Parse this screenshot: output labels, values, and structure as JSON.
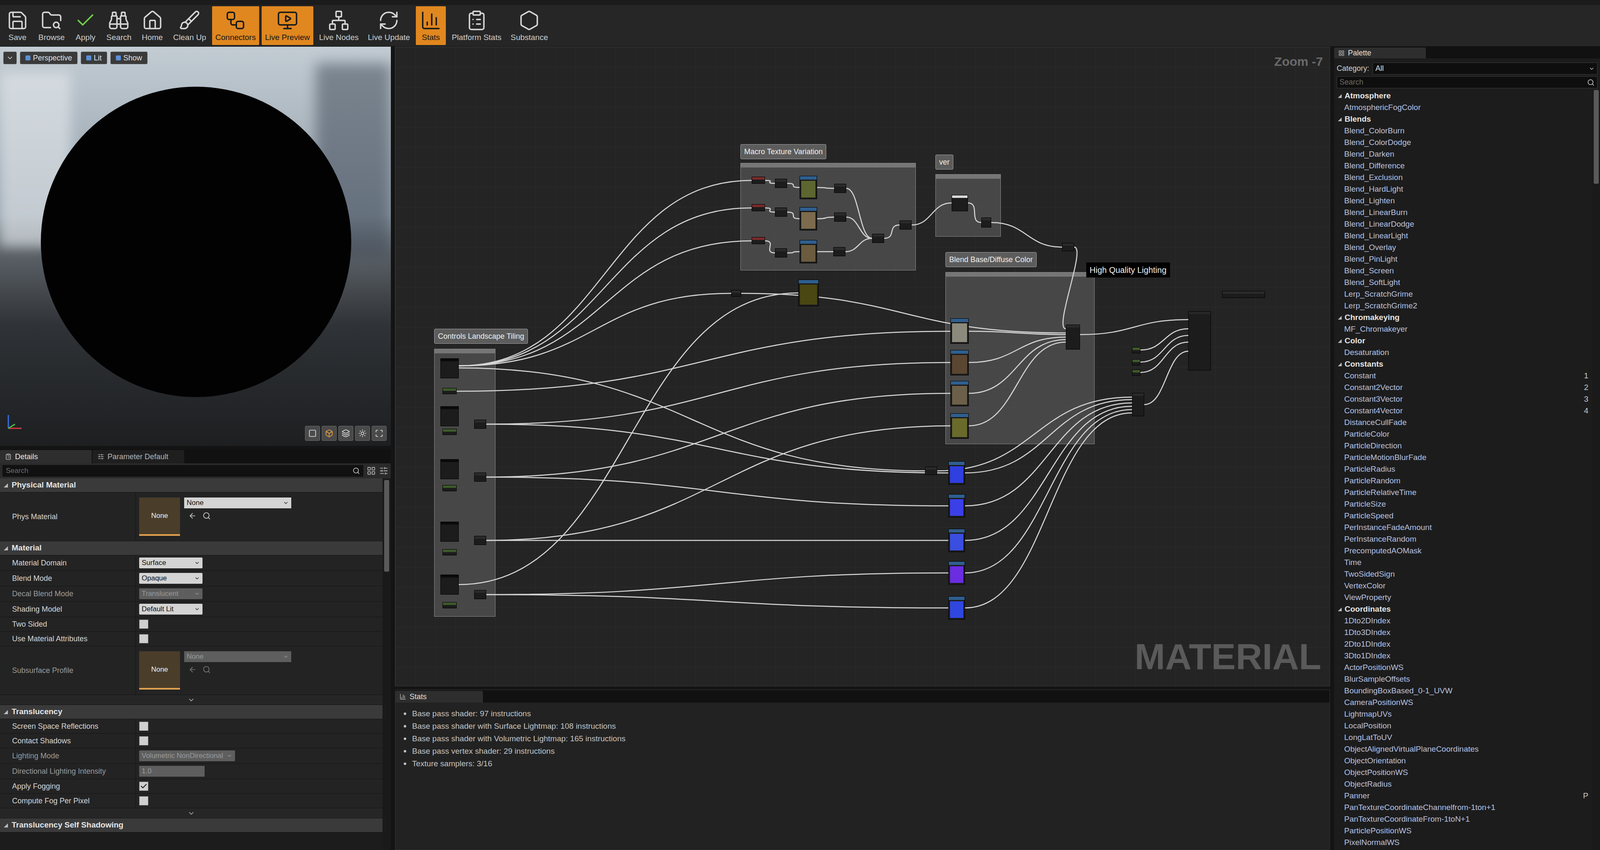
{
  "toolbar": [
    {
      "label": "Save",
      "selected": false
    },
    {
      "label": "Browse",
      "selected": false
    },
    {
      "label": "Apply",
      "selected": false
    },
    {
      "label": "Search",
      "selected": false
    },
    {
      "label": "Home",
      "selected": false
    },
    {
      "label": "Clean Up",
      "selected": false
    },
    {
      "label": "Connectors",
      "selected": true
    },
    {
      "label": "Live Preview",
      "selected": true
    },
    {
      "label": "Live Nodes",
      "selected": false
    },
    {
      "label": "Live Update",
      "selected": false
    },
    {
      "label": "Stats",
      "selected": true
    },
    {
      "label": "Platform Stats",
      "selected": false
    },
    {
      "label": "Substance",
      "selected": false
    }
  ],
  "viewport": {
    "buttons": [
      {
        "label": "Perspective"
      },
      {
        "label": "Lit"
      },
      {
        "label": "Show"
      }
    ]
  },
  "details": {
    "tabs": [
      {
        "label": "Details",
        "selected": true
      },
      {
        "label": "Parameter Default",
        "selected": false
      }
    ],
    "search": "Search",
    "sections": [
      {
        "title": "Physical Material",
        "expanded": true,
        "advanced": false,
        "rows": [
          {
            "label": "Phys Material",
            "kind": "asset",
            "thumb": "None",
            "value": "None",
            "disabled": false
          }
        ]
      },
      {
        "title": "Material",
        "expanded": true,
        "advanced": true,
        "rows": [
          {
            "label": "Material Domain",
            "kind": "select",
            "value": "Surface",
            "disabled": false
          },
          {
            "label": "Blend Mode",
            "kind": "select",
            "value": "Opaque",
            "disabled": false
          },
          {
            "label": "Decal Blend Mode",
            "kind": "select",
            "value": "Translucent",
            "disabled": true
          },
          {
            "label": "Shading Model",
            "kind": "select",
            "value": "Default Lit",
            "disabled": false
          },
          {
            "label": "Two Sided",
            "kind": "checkbox",
            "checked": false,
            "disabled": false
          },
          {
            "label": "Use Material Attributes",
            "kind": "checkbox",
            "checked": false,
            "disabled": false
          },
          {
            "label": "Subsurface Profile",
            "kind": "asset",
            "thumb": "None",
            "value": "None",
            "disabled": true
          }
        ]
      },
      {
        "title": "Translucency",
        "expanded": true,
        "advanced": true,
        "rows": [
          {
            "label": "Screen Space Reflections",
            "kind": "checkbox",
            "checked": false,
            "disabled": false
          },
          {
            "label": "Contact Shadows",
            "kind": "checkbox",
            "checked": false,
            "disabled": false
          },
          {
            "label": "Lighting Mode",
            "kind": "select",
            "value": "Volumetric NonDirectional",
            "disabled": true
          },
          {
            "label": "Directional Lighting Intensity",
            "kind": "number",
            "value": "1.0",
            "disabled": true
          },
          {
            "label": "Apply Fogging",
            "kind": "checkbox",
            "checked": true,
            "disabled": false
          },
          {
            "label": "Compute Fog Per Pixel",
            "kind": "checkbox",
            "checked": false,
            "disabled": false
          }
        ]
      },
      {
        "title": "Translucency Self Shadowing",
        "expanded": true,
        "advanced": false,
        "rows": []
      }
    ]
  },
  "graph": {
    "zoom": "Zoom -7",
    "watermark": "MATERIAL",
    "tooltip": "High Quality Lighting",
    "comments": [
      {
        "title": "Macro Texture Variation"
      },
      {
        "title": "ver"
      },
      {
        "title": "Blend Base/Diffuse Color"
      },
      {
        "title": "Controls Landscape Tiling"
      }
    ],
    "textures": [
      {
        "color": "#5d6630"
      },
      {
        "color": "#7d6b4d"
      },
      {
        "color": "#6b5c3f"
      },
      {
        "color": "#4a4712"
      },
      {
        "color": "#8c8a7c"
      },
      {
        "color": "#5b4631"
      },
      {
        "color": "#6d604a"
      },
      {
        "color": "#6a6a2c"
      },
      {
        "color": "#2f3fe0"
      },
      {
        "color": "#3b3fe8"
      },
      {
        "color": "#3a4ee0"
      },
      {
        "color": "#6a2de0"
      },
      {
        "color": "#3046e0"
      }
    ]
  },
  "stats": {
    "tab": "Stats",
    "lines": [
      "Base pass shader: 97 instructions",
      "Base pass shader with Surface Lightmap: 108 instructions",
      "Base pass shader with Volumetric Lightmap: 165 instructions",
      "Base pass vertex shader: 29 instructions",
      "Texture samplers: 3/16"
    ]
  },
  "palette": {
    "tab": "Palette",
    "category_label": "Category:",
    "category": "All",
    "search": "Search",
    "groups": [
      {
        "title": "Atmosphere",
        "expanded": true,
        "items": [
          {
            "label": "AtmosphericFogColor"
          }
        ]
      },
      {
        "title": "Blends",
        "expanded": true,
        "items": [
          {
            "label": "Blend_ColorBurn"
          },
          {
            "label": "Blend_ColorDodge"
          },
          {
            "label": "Blend_Darken"
          },
          {
            "label": "Blend_Difference"
          },
          {
            "label": "Blend_Exclusion"
          },
          {
            "label": "Blend_HardLight"
          },
          {
            "label": "Blend_Lighten"
          },
          {
            "label": "Blend_LinearBurn"
          },
          {
            "label": "Blend_LinearDodge"
          },
          {
            "label": "Blend_LinearLight"
          },
          {
            "label": "Blend_Overlay"
          },
          {
            "label": "Blend_PinLight"
          },
          {
            "label": "Blend_Screen"
          },
          {
            "label": "Blend_SoftLight"
          },
          {
            "label": "Lerp_ScratchGrime"
          },
          {
            "label": "Lerp_ScratchGrime2"
          }
        ]
      },
      {
        "title": "Chromakeying",
        "expanded": true,
        "items": [
          {
            "label": "MF_Chromakeyer"
          }
        ]
      },
      {
        "title": "Color",
        "expanded": true,
        "items": [
          {
            "label": "Desaturation"
          }
        ]
      },
      {
        "title": "Constants",
        "expanded": true,
        "items": [
          {
            "label": "Constant",
            "shortcut": "1"
          },
          {
            "label": "Constant2Vector",
            "shortcut": "2"
          },
          {
            "label": "Constant3Vector",
            "shortcut": "3"
          },
          {
            "label": "Constant4Vector",
            "shortcut": "4"
          },
          {
            "label": "DistanceCullFade"
          },
          {
            "label": "ParticleColor"
          },
          {
            "label": "ParticleDirection"
          },
          {
            "label": "ParticleMotionBlurFade"
          },
          {
            "label": "ParticleRadius"
          },
          {
            "label": "ParticleRandom"
          },
          {
            "label": "ParticleRelativeTime"
          },
          {
            "label": "ParticleSize"
          },
          {
            "label": "ParticleSpeed"
          },
          {
            "label": "PerInstanceFadeAmount"
          },
          {
            "label": "PerInstanceRandom"
          },
          {
            "label": "PrecomputedAOMask"
          },
          {
            "label": "Time"
          },
          {
            "label": "TwoSidedSign"
          },
          {
            "label": "VertexColor"
          },
          {
            "label": "ViewProperty"
          }
        ]
      },
      {
        "title": "Coordinates",
        "expanded": true,
        "items": [
          {
            "label": "1Dto2DIndex"
          },
          {
            "label": "1Dto3DIndex"
          },
          {
            "label": "2Dto1DIndex"
          },
          {
            "label": "3Dto1DIndex"
          },
          {
            "label": "ActorPositionWS"
          },
          {
            "label": "BlurSampleOffsets"
          },
          {
            "label": "BoundingBoxBased_0-1_UVW"
          },
          {
            "label": "CameraPositionWS"
          },
          {
            "label": "LightmapUVs"
          },
          {
            "label": "LocalPosition"
          },
          {
            "label": "LongLatToUV"
          },
          {
            "label": "ObjectAlignedVirtualPlaneCoordinates"
          },
          {
            "label": "ObjectOrientation"
          },
          {
            "label": "ObjectPositionWS"
          },
          {
            "label": "ObjectRadius"
          },
          {
            "label": "Panner",
            "shortcut": "P"
          },
          {
            "label": "PanTextureCoordinateChannelfrom-1ton+1"
          },
          {
            "label": "PanTextureCoordinateFrom-1toN+1"
          },
          {
            "label": "ParticlePositionWS"
          },
          {
            "label": "PixelNormalWS"
          }
        ]
      }
    ]
  }
}
